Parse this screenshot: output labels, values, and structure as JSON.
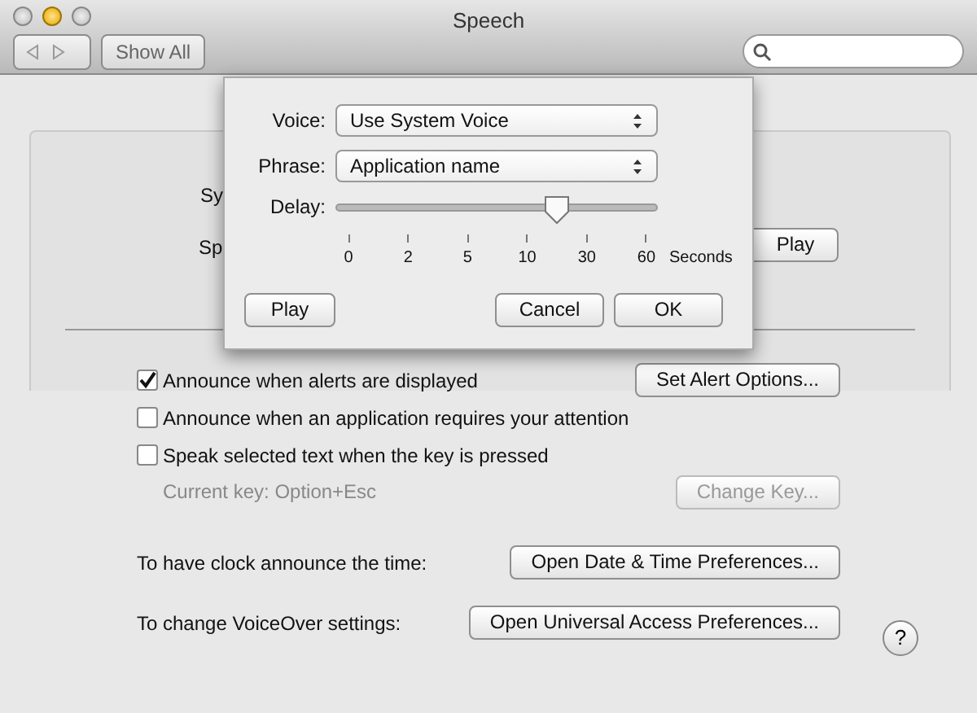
{
  "window": {
    "title": "Speech",
    "show_all": "Show All"
  },
  "background_pane": {
    "system_voice_label": "Sy",
    "speaking_rate_label": "Sp",
    "play_button": "Play"
  },
  "sheet": {
    "voice": {
      "label": "Voice:",
      "value": "Use System Voice"
    },
    "phrase": {
      "label": "Phrase:",
      "value": "Application name"
    },
    "delay": {
      "label": "Delay:",
      "level": 0.69,
      "ticks": [
        "0",
        "2",
        "5",
        "10",
        "30",
        "60"
      ],
      "unit": "Seconds"
    },
    "buttons": {
      "play": "Play",
      "cancel": "Cancel",
      "ok": "OK"
    }
  },
  "options": [
    {
      "label": "Announce when alerts are displayed",
      "checked": true,
      "button": {
        "label": "Set Alert Options...",
        "disabled": false
      }
    },
    {
      "label": "Announce when an application requires your attention",
      "checked": false
    },
    {
      "label": "Speak selected text when the key is pressed",
      "checked": false
    }
  ],
  "current_key": {
    "text": "Current key: Option+Esc",
    "button": {
      "label": "Change Key...",
      "disabled": true
    }
  },
  "rows": [
    {
      "label": "To have clock announce the time:",
      "button": "Open Date & Time Preferences..."
    },
    {
      "label": "To change VoiceOver settings:",
      "button": "Open Universal Access Preferences..."
    }
  ],
  "help": "?"
}
